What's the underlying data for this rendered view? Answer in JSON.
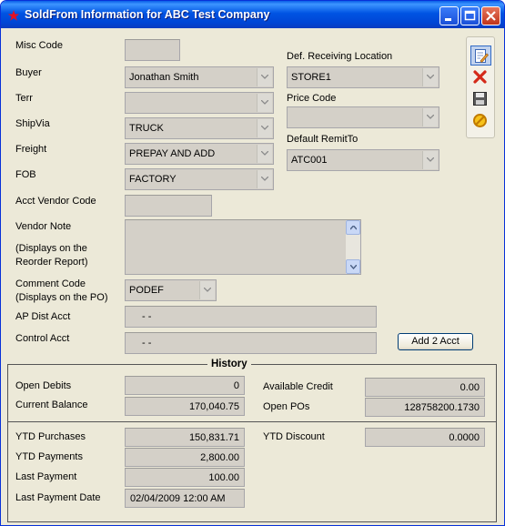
{
  "window": {
    "title": "SoldFrom Information for ABC Test Company",
    "app_icon": "star-app-icon"
  },
  "title_buttons": {
    "minimize_icon": "minimize-icon",
    "maximize_icon": "maximize-icon",
    "close_icon": "close-icon"
  },
  "toolbar": {
    "edit_icon": "edit-document-icon",
    "delete_icon": "delete-x-icon",
    "save_icon": "save-disk-icon",
    "cancel_icon": "cancel-circle-icon"
  },
  "form": {
    "misc_code": {
      "label": "Misc Code",
      "value": ""
    },
    "buyer": {
      "label": "Buyer",
      "value": "Jonathan Smith"
    },
    "terr": {
      "label": "Terr",
      "value": ""
    },
    "shipvia": {
      "label": "ShipVia",
      "value": "TRUCK"
    },
    "freight": {
      "label": "Freight",
      "value": "PREPAY AND ADD"
    },
    "fob": {
      "label": "FOB",
      "value": "FACTORY"
    },
    "acct_vendor_code": {
      "label": "Acct Vendor Code",
      "value": ""
    },
    "vendor_note": {
      "label": "Vendor Note",
      "sublabel_1": "(Displays on the",
      "sublabel_2": "Reorder Report)",
      "value": ""
    },
    "comment_code": {
      "label": "Comment Code",
      "sublabel": "(Displays on the PO)",
      "value": "PODEF"
    },
    "ap_dist_acct": {
      "label": "AP Dist Acct",
      "value": "-   -"
    },
    "control_acct": {
      "label": "Control Acct",
      "value": "-   -"
    },
    "def_receiving_location": {
      "label": "Def. Receiving Location",
      "value": "STORE1"
    },
    "price_code": {
      "label": "Price Code",
      "value": ""
    },
    "default_remitto": {
      "label": "Default RemitTo",
      "value": "ATC001"
    },
    "add_2_acct_button": "Add 2 Acct"
  },
  "history": {
    "title": "History",
    "open_debits": {
      "label": "Open Debits",
      "value": "0"
    },
    "current_balance": {
      "label": "Current Balance",
      "value": "170,040.75"
    },
    "available_credit": {
      "label": "Available Credit",
      "value": "0.00"
    },
    "open_pos": {
      "label": "Open POs",
      "value": "128758200.1730"
    },
    "ytd_purchases": {
      "label": "YTD Purchases",
      "value": "150,831.71"
    },
    "ytd_payments": {
      "label": "YTD Payments",
      "value": "2,800.00"
    },
    "last_payment": {
      "label": "Last Payment",
      "value": "100.00"
    },
    "last_payment_date": {
      "label": "Last Payment Date",
      "value": "02/04/2009 12:00 AM"
    },
    "ytd_discount": {
      "label": "YTD Discount",
      "value": "0.0000"
    }
  }
}
